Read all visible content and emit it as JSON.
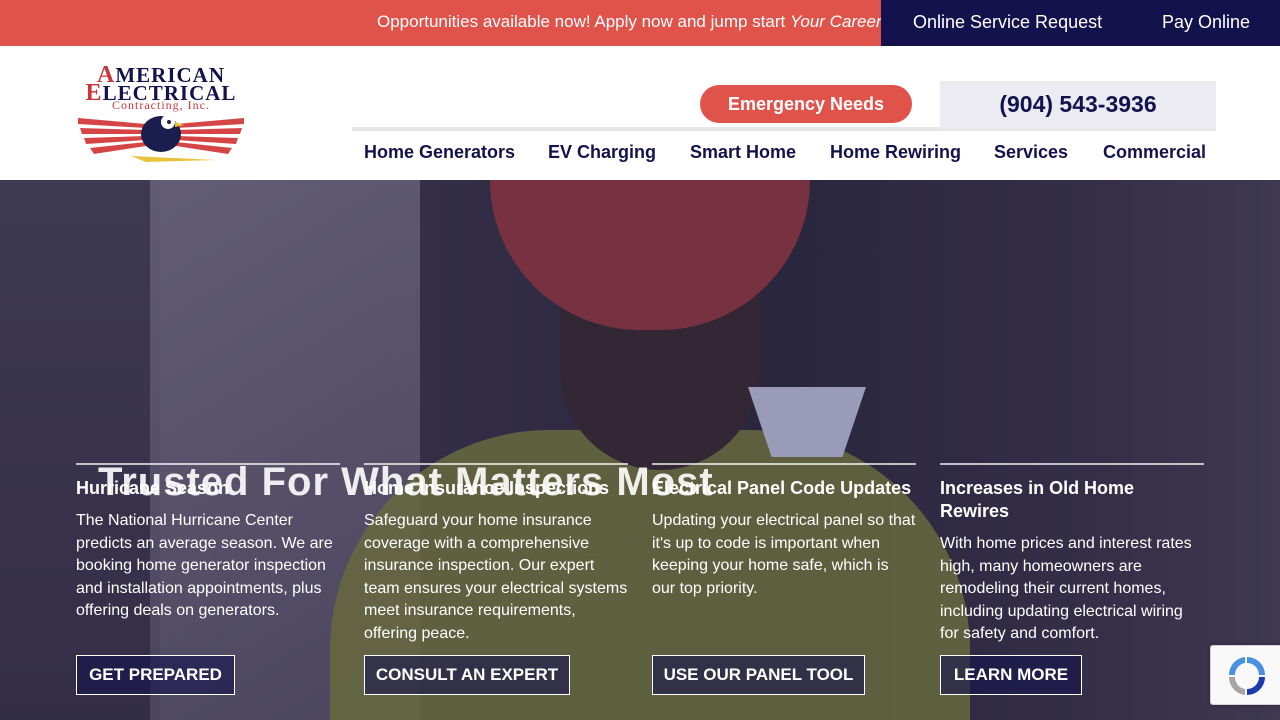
{
  "topbar": {
    "announcement": "Opportunities available now! Apply now and jump start ",
    "announcement_emph": "Your Career",
    "online_service": "Online Service Request",
    "pay_online": "Pay Online"
  },
  "logo": {
    "line1_first": "A",
    "line1_rest": "MERICAN",
    "line2_first": "E",
    "line2_rest": "LECTRICAL",
    "line3": "Contracting, Inc."
  },
  "header": {
    "emergency": "Emergency Needs",
    "phone": "(904) 543-3936"
  },
  "nav": {
    "items": [
      "Home Generators",
      "EV Charging",
      "Smart Home",
      "Home Rewiring",
      "Services",
      "Commercial"
    ]
  },
  "hero": {
    "headline": "Trusted For What Matters Most",
    "cards": [
      {
        "title": "Hurricane Season",
        "text": "The National Hurricane Center predicts an average season. We are booking home generator inspection and installation appointments, plus offering deals on generators.",
        "cta": "GET PREPARED"
      },
      {
        "title": "Home Insurance Inspections",
        "text": "Safeguard your home insurance coverage with a comprehensive insurance inspection. Our expert team ensures your electrical systems meet insurance requirements, offering peace.",
        "cta": "CONSULT AN EXPERT"
      },
      {
        "title": "Electrical Panel Code Updates",
        "text": "Updating your electrical panel so that it's up to code is important when keeping your home safe, which is our top priority.",
        "cta": "USE OUR PANEL TOOL"
      },
      {
        "title": "Increases in Old Home Rewires",
        "text": "With home prices and interest rates high, many homeowners are remodeling their current homes, including updating electrical wiring for safety and comfort.",
        "cta": "LEARN MORE"
      }
    ]
  },
  "colors": {
    "red": "#e0534a",
    "navy": "#14124d"
  }
}
